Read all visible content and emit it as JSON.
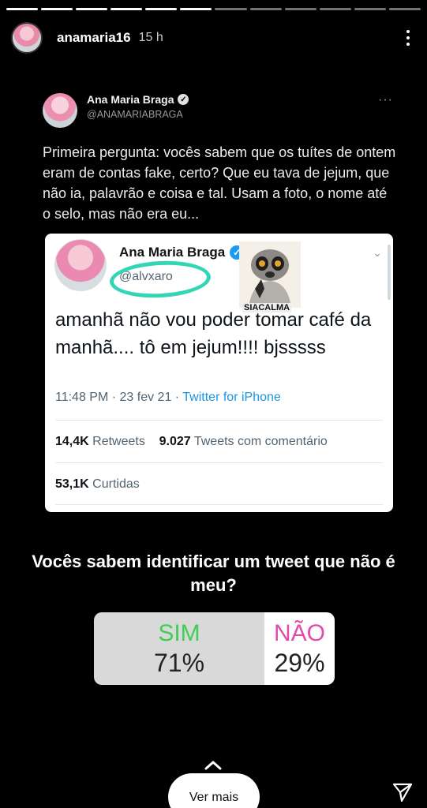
{
  "story": {
    "username": "anamaria16",
    "time": "15 h",
    "segments_total": 12,
    "segments_done": 6
  },
  "tweet": {
    "name": "Ana Maria Braga",
    "handle": "@ANAMARIABRAGA",
    "more": "···",
    "text": "Primeira pergunta: vocês sabem que os tuítes de ontem eram de contas fake, certo? Que eu tava de jejum, que não ia, palavrão e coisa e tal. Usam a foto, o nome até o selo, mas não era eu..."
  },
  "embedded": {
    "name": "Ana Maria Braga",
    "handle": "@alvxaro",
    "sticker_text": "SIACALMA",
    "text": "amanhã não vou poder tomar café da manhã.... tô em jejum!!!! bjsssss",
    "time": "11:48 PM · 23 fev 21 ·",
    "source": "Twitter for iPhone",
    "retweets_value": "14,4K",
    "retweets_label": "Retweets",
    "quotes_value": "9.027",
    "quotes_label": "Tweets com comentário",
    "likes_value": "53,1K",
    "likes_label": "Curtidas"
  },
  "poll": {
    "question": "Vocês sabem identificar um tweet que não é meu?",
    "yes_label": "SIM",
    "yes_percent": "71%",
    "no_label": "NÃO",
    "no_percent": "29%"
  },
  "footer": {
    "see_more": "Ver mais"
  },
  "colors": {
    "yes": "#3fcf55",
    "no": "#e04ca8",
    "highlight_circle": "#33d6b4",
    "twitter_blue": "#1d9bf0"
  },
  "icons": [
    "verified-icon",
    "kebab-menu-icon",
    "chevron-down-icon",
    "chevron-up-icon",
    "send-icon"
  ]
}
